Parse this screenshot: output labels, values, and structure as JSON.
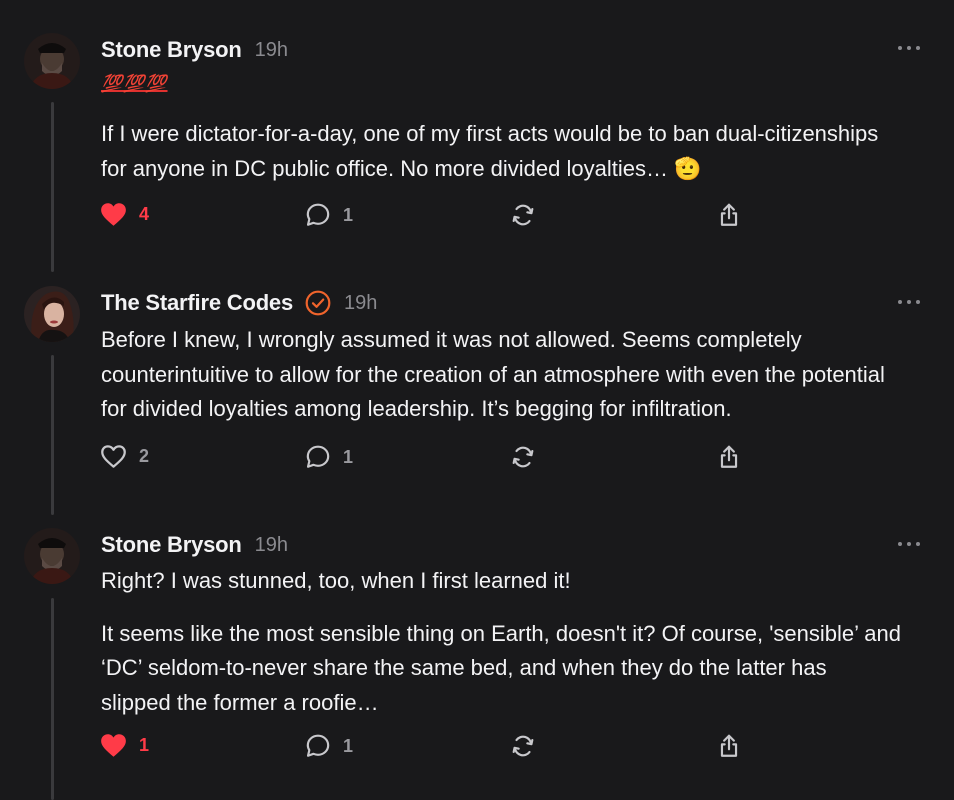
{
  "posts": [
    {
      "author": "Stone Bryson",
      "time": "19h",
      "badge_text": "💯💯💯",
      "verified": false,
      "paragraphs": [
        "If I were dictator-for-a-day, one of my first acts would be to ban dual-citizenships for anyone in DC public office. No more divided loyalties… 🫡"
      ],
      "likes": "4",
      "liked": true,
      "replies": "1"
    },
    {
      "author": "The Starfire Codes",
      "time": "19h",
      "verified": true,
      "paragraphs": [
        "Before I knew, I wrongly assumed it was not allowed. Seems completely counterintuitive to allow for the creation of an atmosphere with even the potential for divided loyalties among leadership. It’s begging for infiltration."
      ],
      "likes": "2",
      "liked": false,
      "replies": "1"
    },
    {
      "author": "Stone Bryson",
      "time": "19h",
      "verified": false,
      "paragraphs": [
        "Right? I was stunned, too, when I first learned it!",
        "It seems like the most sensible thing on Earth, doesn't it? Of course, 'sensible’ and ‘DC’ seldom-to-never share the same bed, and when they do the latter has slipped the former a roofie…"
      ],
      "likes": "1",
      "liked": true,
      "replies": "1"
    }
  ],
  "colors": {
    "background": "#19191b",
    "liked": "#ff3b48",
    "muted": "#8a8a8f",
    "verified": "#f0642c"
  }
}
